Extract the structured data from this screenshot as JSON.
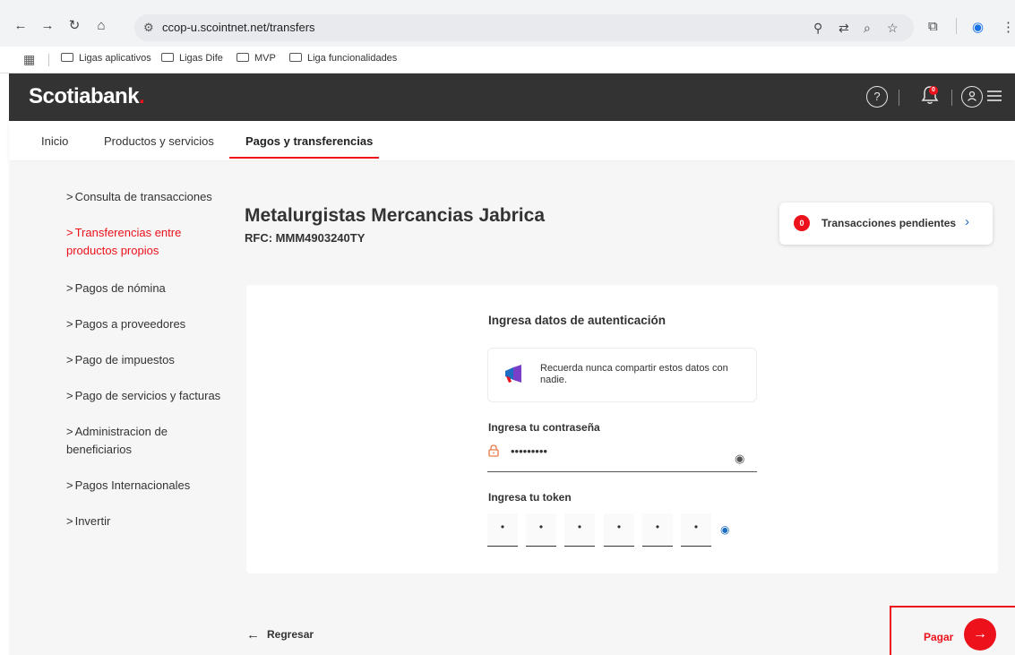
{
  "browser": {
    "url": "ccop-u.scointnet.net/transfers",
    "bookmarks": [
      "Ligas aplicativos",
      "Ligas Dife",
      "MVP",
      "Liga funcionalidades"
    ]
  },
  "header": {
    "logo": "Scotiabank",
    "logo_dot": ".",
    "help_icon": "?",
    "notifications_count": "0"
  },
  "main_nav": {
    "items": [
      "Inicio",
      "Productos y servicios",
      "Pagos y transferencias"
    ]
  },
  "sidebar": {
    "items": [
      "Consulta de transacciones",
      "Transferencias entre productos propios",
      "Pagos de nómina",
      "Pagos a proveedores",
      "Pago de impuestos",
      "Pago de servicios y facturas",
      "Administracion de beneficiarios",
      "Pagos Internacionales",
      "Invertir"
    ]
  },
  "company": {
    "name": "Metalurgistas Mercancias Jabrica",
    "rfc": "RFC: MMM4903240TY"
  },
  "pending": {
    "count": "0",
    "label": "Transacciones pendientes"
  },
  "auth": {
    "title": "Ingresa datos de autenticación",
    "notice": "Recuerda nunca compartir estos datos con nadie.",
    "password_label": "Ingresa tu contraseña",
    "password_value": "•••••••••",
    "token_label": "Ingresa tu token",
    "token_digits": [
      "•",
      "•",
      "•",
      "•",
      "•",
      "•"
    ]
  },
  "footer": {
    "back_label": "Regresar",
    "pay_label": "Pagar"
  },
  "colors": {
    "brand_red": "#ec111a",
    "header_dark": "#333333",
    "link_blue": "#1d6dc2"
  }
}
